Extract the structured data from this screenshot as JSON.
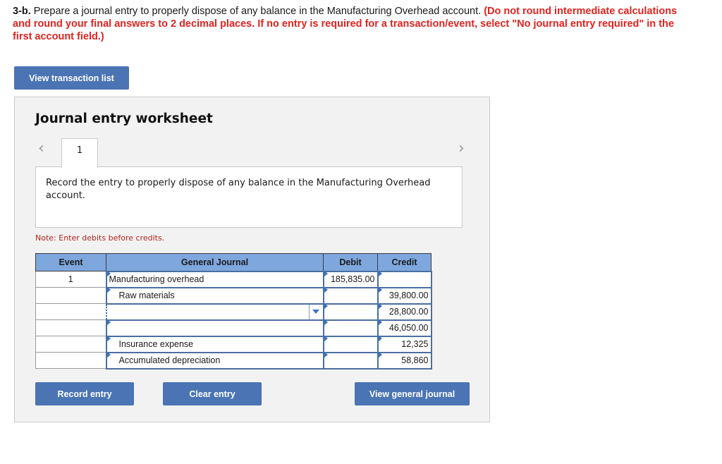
{
  "instructions": {
    "question_number": "3-b.",
    "text": " Prepare a journal entry to properly dispose of any balance in the Manufacturing Overhead account. ",
    "red_text": "(Do not round intermediate calculations and round your final answers to 2 decimal places. If no entry is required for a transaction/event, select \"No journal entry required\" in the first account field.)"
  },
  "buttons": {
    "view_transaction_list": "View transaction list",
    "record_entry": "Record entry",
    "clear_entry": "Clear entry",
    "view_general_journal": "View general journal"
  },
  "worksheet": {
    "title": "Journal entry worksheet",
    "prev_icon": "‹",
    "next_icon": "›",
    "tabs": [
      {
        "label": "1",
        "active": true
      }
    ],
    "description": "Record the entry to properly dispose of any balance in the Manufacturing Overhead account.",
    "note": "Note: Enter debits before credits."
  },
  "journal": {
    "headers": {
      "event": "Event",
      "account": "General Journal",
      "debit": "Debit",
      "credit": "Credit"
    },
    "rows": [
      {
        "event": "1",
        "account": "Manufacturing overhead",
        "indent": false,
        "debit": "185,835.00",
        "credit": ""
      },
      {
        "event": "",
        "account": "Raw materials",
        "indent": true,
        "debit": "",
        "credit": "39,800.00"
      },
      {
        "event": "",
        "account": "",
        "indent": false,
        "debit": "",
        "credit": "28,800.00",
        "dropdown": true
      },
      {
        "event": "",
        "account": "",
        "indent": false,
        "debit": "",
        "credit": "46,050.00"
      },
      {
        "event": "",
        "account": "Insurance expense",
        "indent": true,
        "debit": "",
        "credit": "12,325"
      },
      {
        "event": "",
        "account": "Accumulated depreciation",
        "indent": true,
        "debit": "",
        "credit": "58,860"
      }
    ]
  },
  "colors": {
    "button_blue": "#4a74b4",
    "header_blue": "#7ea7dd",
    "instruction_red": "#e0231f",
    "note_red": "#b3261e"
  }
}
